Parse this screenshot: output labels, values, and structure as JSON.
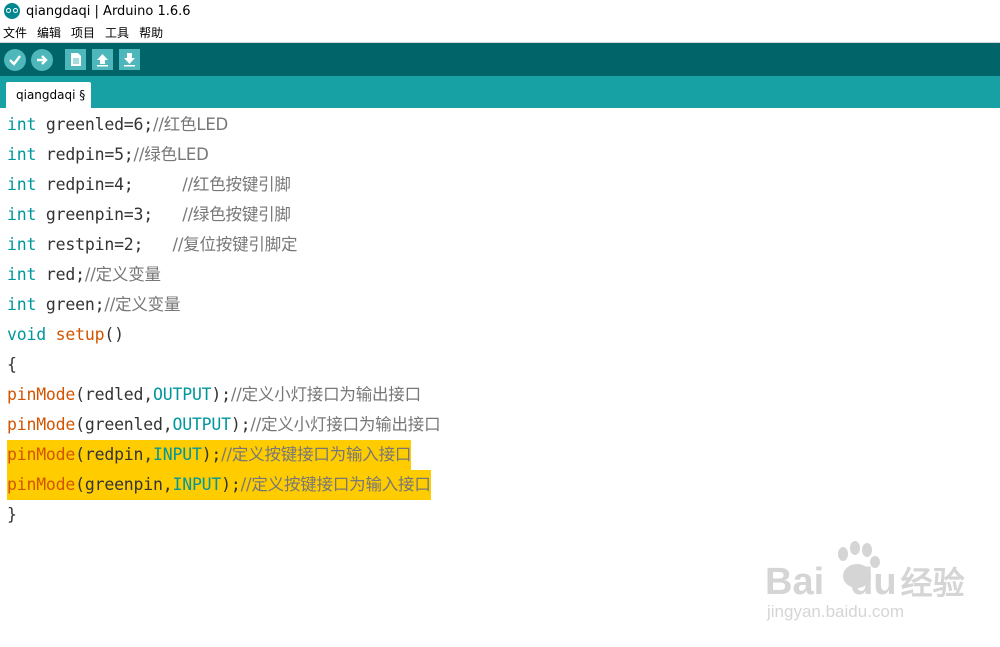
{
  "window": {
    "title": "qiangdaqi | Arduino 1.6.6"
  },
  "menu": [
    "文件",
    "编辑",
    "项目",
    "工具",
    "帮助"
  ],
  "tab": {
    "label": "qiangdaqi §"
  },
  "code": {
    "l1": {
      "kw": "int",
      "rest": " greenled=6;",
      "cmt": "//红色LED"
    },
    "l2": {
      "kw": "int",
      "rest": " redpin=5;",
      "cmt": "//绿色LED"
    },
    "l3": {
      "kw": "int",
      "rest": " redpin=4;     ",
      "cmt": "//红色按键引脚"
    },
    "l4": {
      "kw": "int",
      "rest": " greenpin=3;   ",
      "cmt": "//绿色按键引脚"
    },
    "l5": {
      "kw": "int",
      "rest": " restpin=2;   ",
      "cmt": "//复位按键引脚定"
    },
    "l6": {
      "kw": "int",
      "rest": " red;",
      "cmt": "//定义变量"
    },
    "l7": {
      "kw": "int",
      "rest": " green;",
      "cmt": "//定义变量"
    },
    "l8": {
      "kw": "void",
      "fn": "setup",
      "rest": "()"
    },
    "l9": {
      "rest": "{"
    },
    "l10": {
      "fn": "pinMode",
      "arg": "(redled,",
      "const": "OUTPUT",
      "end": ");",
      "cmt": "//定义小灯接口为输出接口"
    },
    "l11": {
      "fn": "pinMode",
      "arg": "(greenled,",
      "const": "OUTPUT",
      "end": ");",
      "cmt": "//定义小灯接口为输出接口"
    },
    "l12": {
      "fn": "pinMode",
      "arg": "(redpin,",
      "const": "INPUT",
      "end": ");",
      "cmt": "//定义按键接口为输入接口"
    },
    "l13": {
      "fn": "pinMode",
      "arg": "(greenpin,",
      "const": "INPUT",
      "end": ");",
      "cmt": "//定义按键接口为输入接口"
    },
    "l14": {
      "rest": "}"
    }
  },
  "watermark": {
    "brand": "Bai",
    "brand2": "du",
    "cn": "经验",
    "url": "jingyan.baidu.com"
  }
}
